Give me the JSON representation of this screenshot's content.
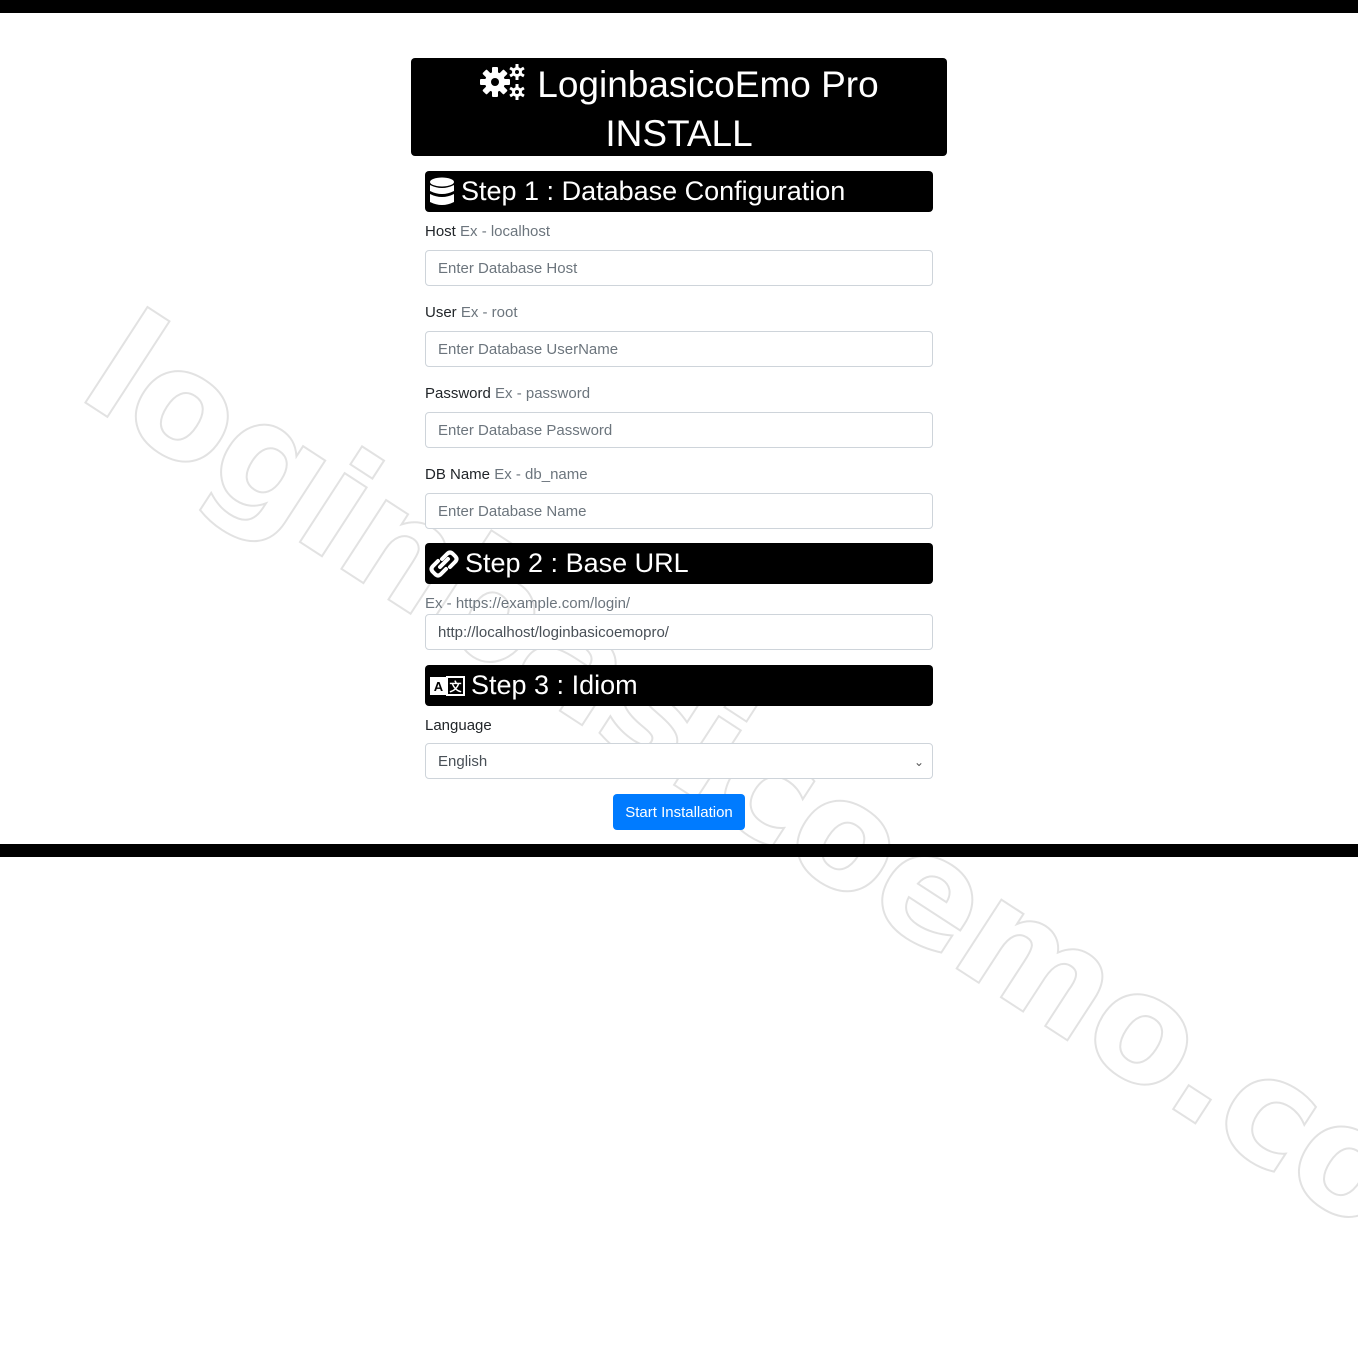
{
  "header": {
    "icon": "gears-icon",
    "title_line1": "LoginbasicoEmo Pro",
    "title_line2": "INSTALL"
  },
  "watermark": "loginbasicoemo.com",
  "step1": {
    "icon": "database-icon",
    "title": "Step 1 : Database Configuration",
    "fields": [
      {
        "label": "Host",
        "example": "Ex - localhost",
        "placeholder": "Enter Database Host",
        "value": ""
      },
      {
        "label": "User",
        "example": "Ex - root",
        "placeholder": "Enter Database UserName",
        "value": ""
      },
      {
        "label": "Password",
        "example": "Ex - password",
        "placeholder": "Enter Database Password",
        "value": ""
      },
      {
        "label": "DB Name",
        "example": "Ex - db_name",
        "placeholder": "Enter Database Name",
        "value": ""
      }
    ]
  },
  "step2": {
    "icon": "link-icon",
    "title": "Step 2 : Base URL",
    "example": "Ex - https://example.com/login/",
    "value": "http://localhost/loginbasicoemopro/"
  },
  "step3": {
    "icon": "translate-icon",
    "title": "Step 3 : Idiom",
    "label": "Language",
    "selected": "English"
  },
  "submit_label": "Start Installation",
  "colors": {
    "primary": "#007bff",
    "header_bg": "#000000"
  }
}
